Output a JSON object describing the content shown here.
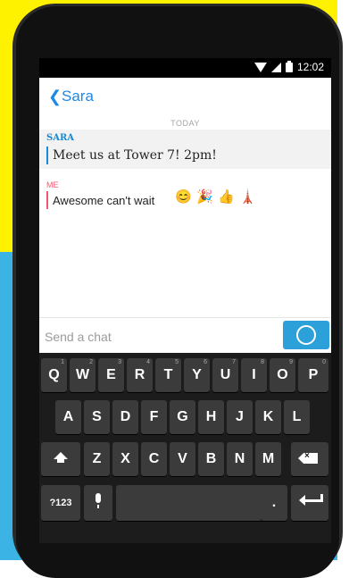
{
  "status_bar": {
    "time": "12:02"
  },
  "header": {
    "back_glyph": "❮",
    "title": "Sara"
  },
  "chat": {
    "date_divider": "TODAY",
    "messages": [
      {
        "sender": "SARA",
        "text": "Meet us at Tower 7! 2pm!",
        "color": "#1a8ad6"
      },
      {
        "sender": "ME",
        "text": "Awesome can't wait",
        "color": "#ef5a6f"
      }
    ],
    "emojis": [
      "😊",
      "🎉",
      "👍",
      "🗼"
    ]
  },
  "composer": {
    "placeholder": "Send a chat",
    "camera_color": "#2ba0d9"
  },
  "keyboard": {
    "row1": [
      {
        "k": "Q",
        "h": "1"
      },
      {
        "k": "W",
        "h": "2"
      },
      {
        "k": "E",
        "h": "3"
      },
      {
        "k": "R",
        "h": "4"
      },
      {
        "k": "T",
        "h": "5"
      },
      {
        "k": "Y",
        "h": "6"
      },
      {
        "k": "U",
        "h": "7"
      },
      {
        "k": "I",
        "h": "8"
      },
      {
        "k": "O",
        "h": "9"
      },
      {
        "k": "P",
        "h": "0"
      }
    ],
    "row2": [
      "A",
      "S",
      "D",
      "F",
      "G",
      "H",
      "J",
      "K",
      "L"
    ],
    "row3": [
      "Z",
      "X",
      "C",
      "V",
      "B",
      "N",
      "M"
    ],
    "symbols_label": "?123",
    "period_label": "."
  }
}
